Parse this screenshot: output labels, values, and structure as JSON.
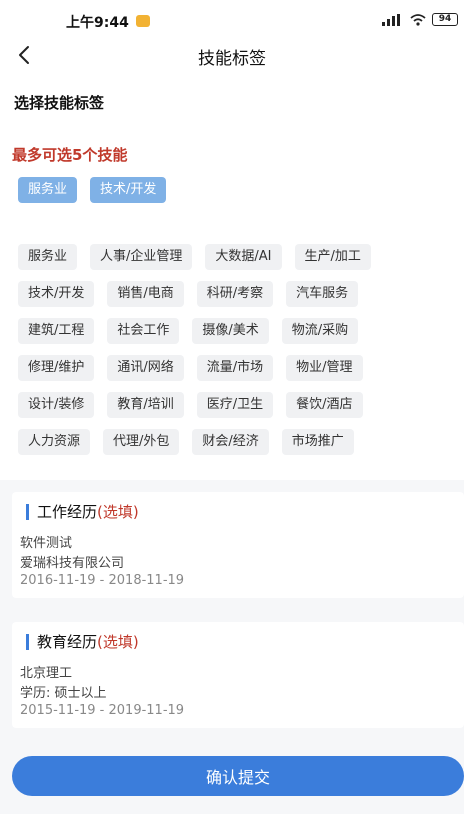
{
  "status": {
    "time": "上午9:44",
    "battery": "94"
  },
  "nav": {
    "title": "技能标签"
  },
  "section_label": "选择技能标签",
  "limit_text": "最多可选5个技能",
  "selected": [
    "服务业",
    "技术/开发"
  ],
  "tags": [
    [
      "服务业",
      "人事/企业管理",
      "大数据/AI",
      "生产/加工"
    ],
    [
      "技术/开发",
      "销售/电商",
      "科研/考察",
      "汽车服务"
    ],
    [
      "建筑/工程",
      "社会工作",
      "摄像/美术",
      "物流/采购"
    ],
    [
      "修理/维护",
      "通讯/网络",
      "流量/市场",
      "物业/管理"
    ],
    [
      "设计/装修",
      "教育/培训",
      "医疗/卫生",
      "餐饮/酒店"
    ],
    [
      "人力资源",
      "代理/外包",
      "财会/经济",
      "市场推广"
    ]
  ],
  "work": {
    "title": "工作经历",
    "optional": "(选填)",
    "position": "软件测试",
    "company": "爱瑞科技有限公司",
    "period": "2016-11-19 - 2018-11-19"
  },
  "edu": {
    "title": "教育经历",
    "optional": "(选填)",
    "school": "北京理工",
    "degree": "学历: 硕士以上",
    "period": "2015-11-19 - 2019-11-19"
  },
  "submit_label": "确认提交",
  "colors": {
    "accent": "#3b7ddb",
    "selected_tag": "#7fb1e6",
    "warning": "#c0392b"
  }
}
